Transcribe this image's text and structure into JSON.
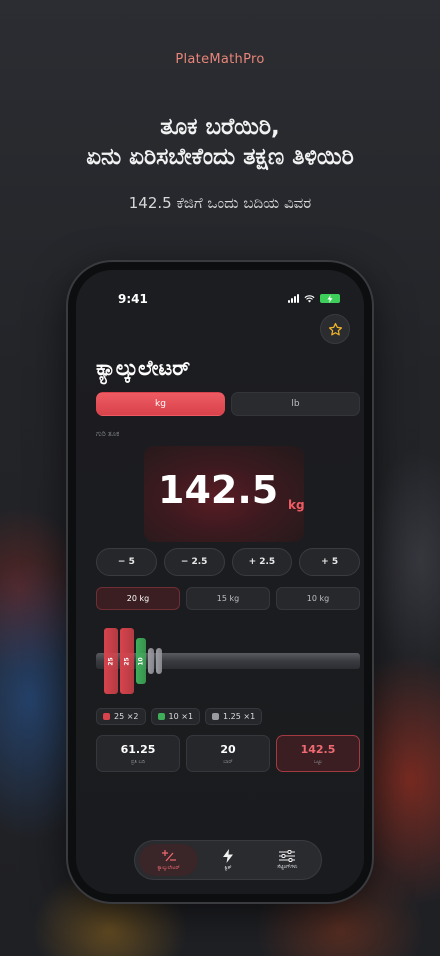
{
  "app": {
    "brand": "PlateMathPro",
    "headline_line1": "ತೂಕ ಬರೆಯಿರಿ,",
    "headline_line2": "ಏನು ಏರಿಸಬೇಕೆಂದು ತಕ್ಷಣ ತಿಳಿಯಿರಿ",
    "subline": "142.5 ಕೆಜಿಗೆ ಒಂದು ಬದಿಯ ವಿವರ"
  },
  "status_bar": {
    "time": "9:41"
  },
  "screen": {
    "title": "ಕ್ಯಾಲ್ಕುಲೇಟರ್",
    "units": [
      {
        "label": "kg",
        "active": true
      },
      {
        "label": "lb",
        "active": false
      }
    ],
    "target_label": "ಗುರಿ ತೂಕ",
    "target_value": "142.5",
    "target_unit": "kg",
    "steps": [
      "− 5",
      "− 2.5",
      "+ 2.5",
      "+ 5"
    ],
    "bars": [
      {
        "label": "20 kg",
        "active": true
      },
      {
        "label": "15 kg",
        "active": false
      },
      {
        "label": "10 kg",
        "active": false
      }
    ],
    "plates": [
      {
        "label": "25",
        "color": "#d8434c"
      },
      {
        "label": "25",
        "color": "#d8434c"
      },
      {
        "label": "10",
        "color": "#3fae5a"
      },
      {
        "label": "",
        "color": "#9a9ba0"
      },
      {
        "label": "",
        "color": "#9a9ba0"
      }
    ],
    "legend": [
      {
        "label": "25 ×2",
        "color": "#d8434c"
      },
      {
        "label": "10 ×1",
        "color": "#3fae5a"
      },
      {
        "label": "1.25 ×1",
        "color": "#9a9ba0"
      }
    ],
    "stats": [
      {
        "value": "61.25",
        "label": "ಪ್ರತಿ ಬದಿ"
      },
      {
        "value": "20",
        "label": "ಬಾರ್"
      },
      {
        "value": "142.5",
        "label": "ಒಟ್ಟು"
      }
    ]
  },
  "tabbar": {
    "items": [
      {
        "label": "ಕ್ಯಾಲ್ಕುಲೇಟರ್",
        "icon": "plus-minus-icon",
        "active": true
      },
      {
        "label": "ಕ್ವಿಕ್",
        "icon": "lightning-icon",
        "active": false
      },
      {
        "label": "ಸೆಟ್ಟಿಂಗ್‌ಗಳು",
        "icon": "sliders-icon",
        "active": false
      }
    ]
  },
  "colors": {
    "accent": "#ef5b62",
    "brand": "#e8857a"
  }
}
